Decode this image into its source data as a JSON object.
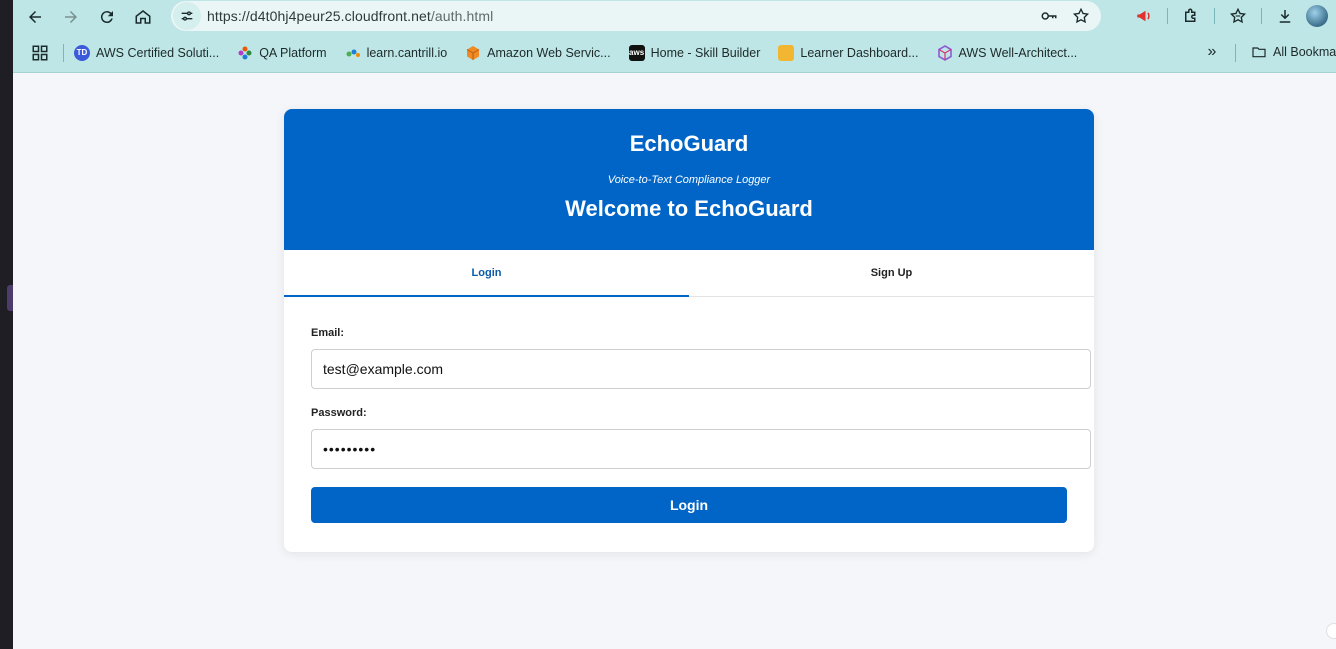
{
  "browser": {
    "url_host": "https://d4t0hj4peur25.cloudfront.net",
    "url_path": "/auth.html",
    "bookmarks": [
      {
        "label": "AWS Certified Soluti...",
        "icon": "td-icon",
        "color": "#3b5bdb"
      },
      {
        "label": "QA Platform",
        "icon": "pinwheel-icon",
        "color": "#e8590c"
      },
      {
        "label": "learn.cantrill.io",
        "icon": "dots-icon",
        "color": "#4caf50"
      },
      {
        "label": "Amazon Web Servic...",
        "icon": "aws-cube-icon",
        "color": "#f08a24"
      },
      {
        "label": "Home - Skill Builder",
        "icon": "aws-icon",
        "color": "#111111"
      },
      {
        "label": "Learner Dashboard...",
        "icon": "box-icon",
        "color": "#f2b632"
      },
      {
        "label": "AWS Well-Architect...",
        "icon": "hex-icon",
        "color": "#8e5bd6"
      }
    ],
    "all_bookmarks": "All Bookma"
  },
  "app": {
    "brand": "EchoGuard",
    "tagline": "Voice-to-Text Compliance Logger",
    "welcome": "Welcome to EchoGuard",
    "tabs": {
      "login": "Login",
      "signup": "Sign Up"
    },
    "active_tab": "login",
    "form": {
      "email_label": "Email:",
      "email_value": "test@example.com",
      "password_label": "Password:",
      "password_value": "•••••••••",
      "submit_label": "Login"
    },
    "colors": {
      "primary": "#0165c8",
      "page_bg": "#f4f6f9",
      "chrome": "#bfe6e6"
    }
  }
}
